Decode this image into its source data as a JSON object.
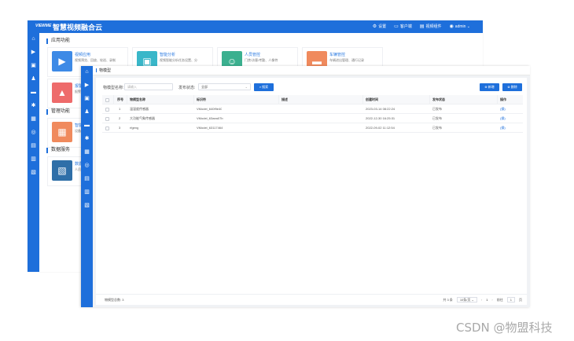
{
  "app": {
    "logo_text": "VIEWME",
    "title": "智慧视频融合云"
  },
  "topbar": {
    "items": [
      {
        "icon": "settings-icon",
        "glyph": "⚙",
        "label": "设置"
      },
      {
        "icon": "client-icon",
        "glyph": "▭",
        "label": "客户端"
      },
      {
        "icon": "video-component-icon",
        "glyph": "▤",
        "label": "视频组件"
      },
      {
        "icon": "user-icon",
        "glyph": "◉",
        "label": "admin ⌄"
      }
    ]
  },
  "back_page": {
    "section_app": "应用功能",
    "section_manage": "管理功能",
    "section_data": "数据服务",
    "cards": [
      {
        "title": "视频应用",
        "desc": "视频预览、回放、轮巡、录制",
        "icon": "camera-icon",
        "glyph": "▶",
        "color": "#3d8ae6"
      },
      {
        "title": "智能分析",
        "desc": "视频智能分析任务设置、分",
        "icon": "monitor-icon",
        "glyph": "▣",
        "color": "#39b7c9"
      },
      {
        "title": "人员管控",
        "desc": "门禁/访客/考勤、人像特",
        "icon": "person-icon",
        "glyph": "☺",
        "color": "#3bb08f"
      },
      {
        "title": "车辆管控",
        "desc": "车辆进出管理、通行记录",
        "icon": "car-icon",
        "glyph": "▬",
        "color": "#f08a5d"
      },
      {
        "title": "报警",
        "desc": "报警",
        "icon": "alarm-icon",
        "glyph": "▲",
        "color": "#ee6b6b"
      },
      {
        "title": "智能",
        "desc": "设备",
        "icon": "device-icon",
        "glyph": "▦",
        "color": "#f08a5d"
      },
      {
        "title": "数据",
        "desc": "人员",
        "icon": "data-icon",
        "glyph": "▧",
        "color": "#2f6fa8"
      }
    ]
  },
  "front_page": {
    "tab": "物模型",
    "filters": {
      "name_label": "物模型名称:",
      "name_placeholder": "请输入",
      "status_label": "发布状态:",
      "status_value": "全部",
      "search_button": "⌕ 搜索"
    },
    "actions": {
      "add_button": "⊕ 新增",
      "delete_button": "⊗ 删除"
    },
    "table": {
      "headers": [
        "序号",
        "物模型名称",
        "标识符",
        "描述",
        "创建时间",
        "发布状态",
        "操作"
      ],
      "rows": [
        {
          "index": "1",
          "name": "温湿度传感器",
          "identifier": "VModel_640f9e40",
          "desc": "",
          "created": "2023-03-14 08:22:24",
          "status": "已发布",
          "action": "(操)"
        },
        {
          "index": "2",
          "name": "大功能气象传感器",
          "identifier": "VModel_63aea07b",
          "desc": "",
          "created": "2022-12-30 16:25:31",
          "status": "已发布",
          "action": "(操)"
        },
        {
          "index": "3",
          "name": "rfgeng",
          "identifier": "VModel_63117464",
          "desc": "",
          "created": "2022-09-02 11:12:54",
          "status": "已发布",
          "action": "(操)"
        }
      ]
    },
    "footer": {
      "total_label": "物模型总数:",
      "total_value": "3",
      "pager_total": "共 3 条",
      "page_size": "10条/页 ⌄",
      "prev": "‹",
      "first": "«",
      "page": "1",
      "next": "›",
      "goto_label": "前往",
      "goto_page": "1",
      "goto_unit": "页"
    }
  },
  "watermark": "CSDN @物盟科技"
}
